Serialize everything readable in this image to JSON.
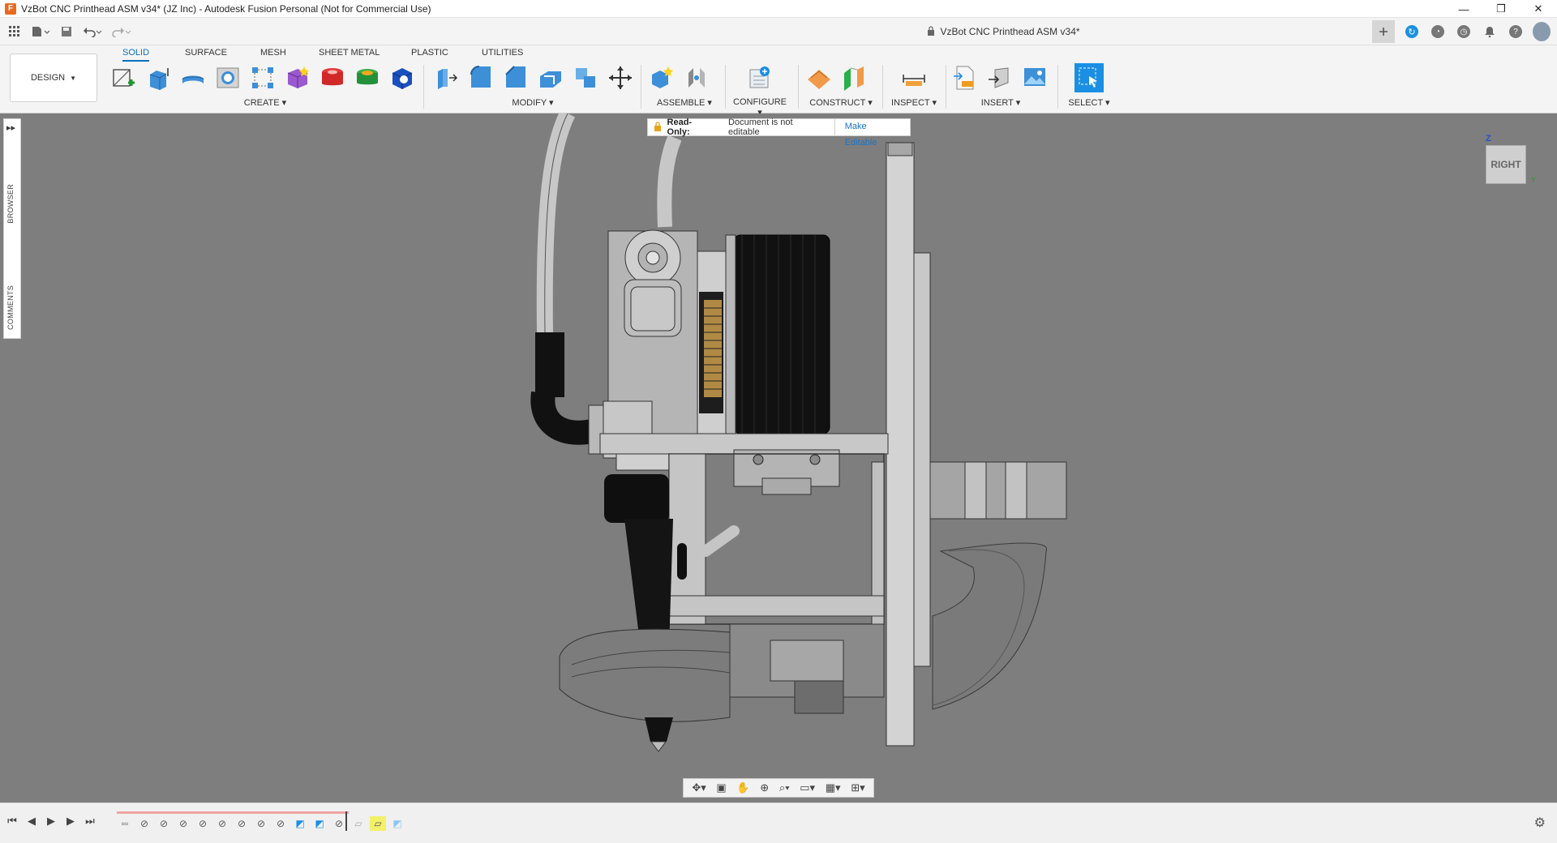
{
  "window": {
    "title": "VzBot CNC Printhead ASM v34* (JZ Inc) - Autodesk Fusion Personal (Not for Commercial Use)",
    "minimize_glyph": "—",
    "restore_glyph": "❐",
    "close_glyph": "✕"
  },
  "document_tab": {
    "name": "VzBot CNC Printhead ASM v34*",
    "close_glyph": "✕"
  },
  "ribbon": {
    "workspace": "DESIGN",
    "tabs": [
      "SOLID",
      "SURFACE",
      "MESH",
      "SHEET METAL",
      "PLASTIC",
      "UTILITIES"
    ],
    "active_tab": "SOLID",
    "groups": [
      "CREATE",
      "MODIFY",
      "ASSEMBLE",
      "CONFIGURE",
      "CONSTRUCT",
      "INSPECT",
      "INSERT",
      "SELECT"
    ]
  },
  "left_panel": {
    "browser": "BROWSER",
    "comments": "COMMENTS"
  },
  "readonly_banner": {
    "title": "Read-Only:",
    "message": "Document is not editable",
    "action": "Make Editable"
  },
  "viewcube": {
    "face": "RIGHT",
    "axis_z": "Z",
    "axis_y": "Y"
  },
  "colors": {
    "accent": "#0c6fbe",
    "viewport_bg": "#7e7e7e",
    "ribbon_bg": "#f4f4f4",
    "timeline_progress": "#f0a3a3",
    "select_blue": "#1a8fe3"
  }
}
